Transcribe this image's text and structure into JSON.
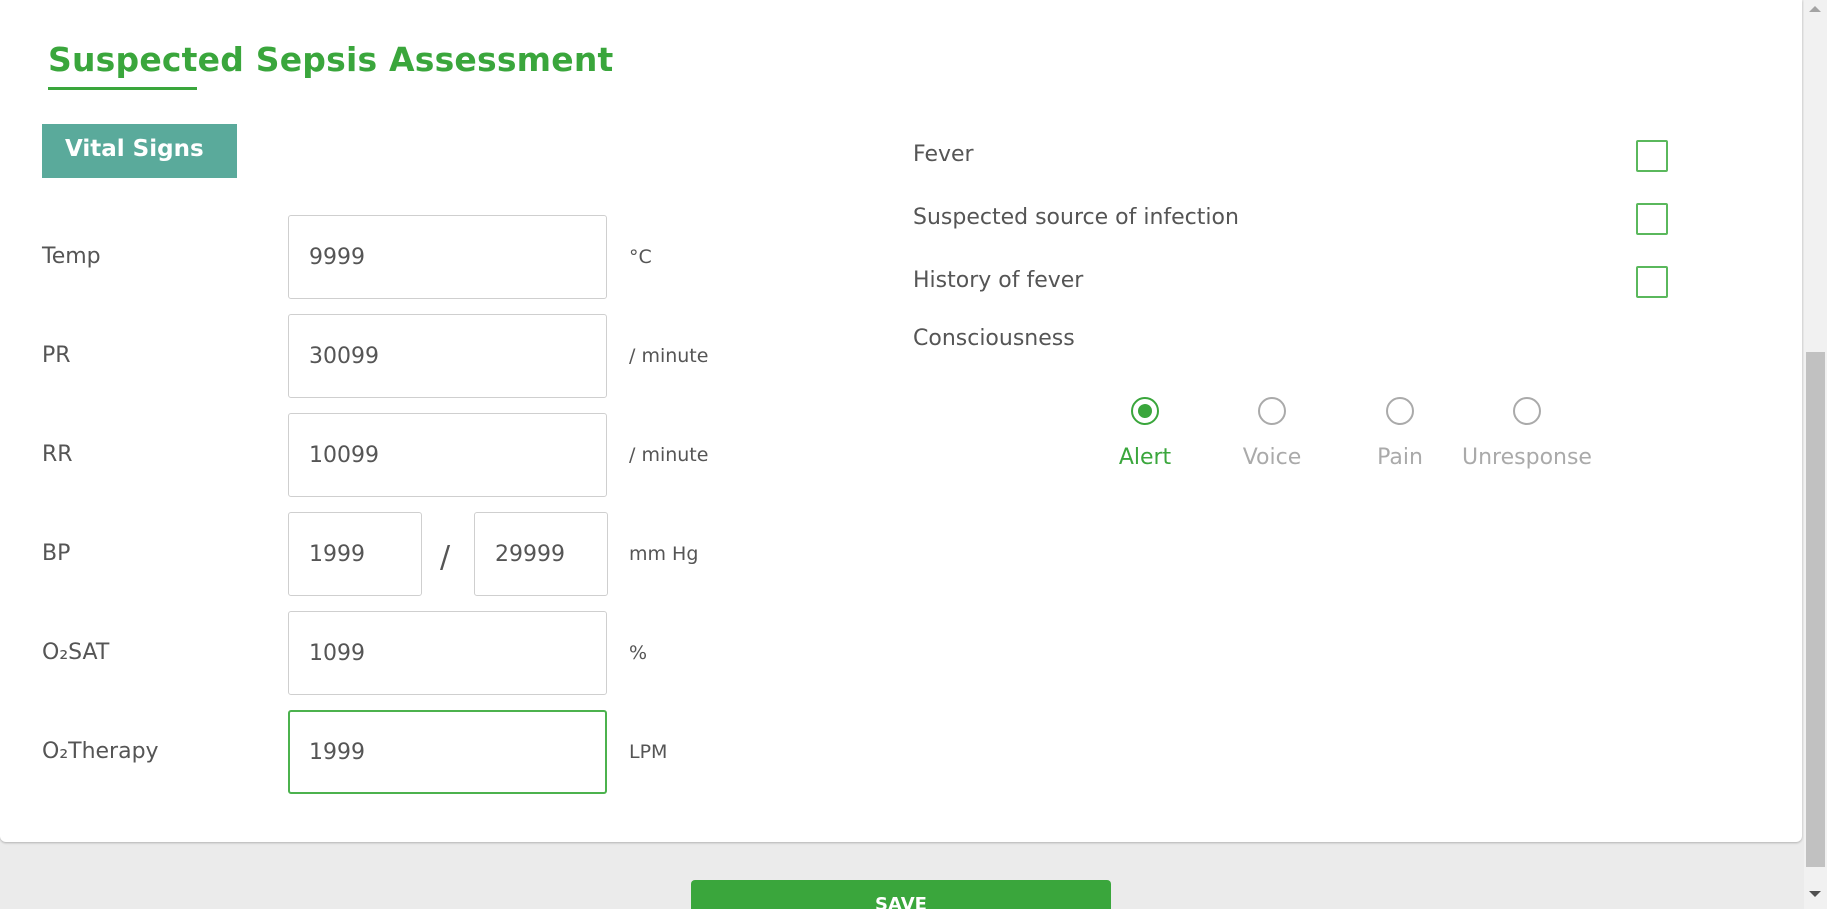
{
  "form": {
    "title": "Suspected Sepsis Assessment",
    "section_tag": "Vital Signs",
    "vitals": {
      "temp": {
        "label": "Temp",
        "value": "9999",
        "unit": "°C"
      },
      "pr": {
        "label": "PR",
        "value": "30099",
        "unit": "/ minute"
      },
      "rr": {
        "label": "RR",
        "value": "10099",
        "unit": "/ minute"
      },
      "bp": {
        "label": "BP",
        "systolic": "1999",
        "separator": "/",
        "diastolic": "29999",
        "unit": "mm Hg"
      },
      "o2sat": {
        "label": "O₂SAT",
        "value": "1099",
        "unit": "%"
      },
      "o2therapy": {
        "label": "O₂Therapy",
        "value": "1999",
        "unit": "LPM"
      }
    },
    "checks": [
      {
        "label": "Fever",
        "checked": false
      },
      {
        "label": "Suspected source of infection",
        "checked": false
      },
      {
        "label": "History of fever",
        "checked": false
      }
    ],
    "consciousness": {
      "label": "Consciousness",
      "options": [
        "Alert",
        "Voice",
        "Pain",
        "Unresponse"
      ],
      "selected": "Alert"
    },
    "save_label": "SAVE"
  },
  "colors": {
    "accent": "#3aa63c",
    "section_tag": "#5aaa9b",
    "muted": "#aaaaaa"
  }
}
